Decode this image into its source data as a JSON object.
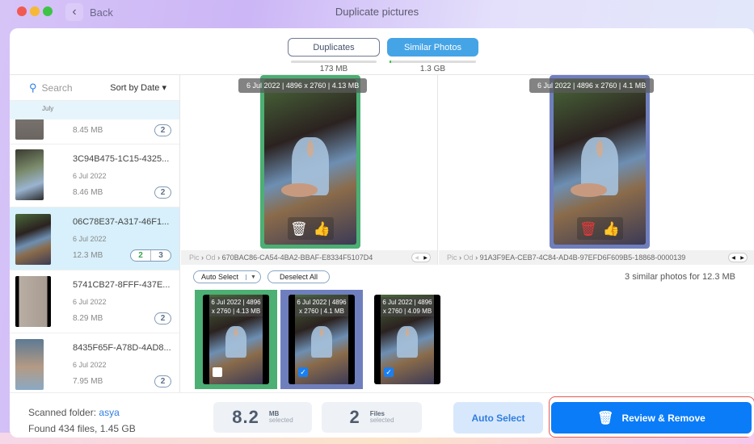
{
  "window": {
    "title": "Duplicate pictures",
    "back_label": "Back"
  },
  "tabs": [
    {
      "label": "Duplicates",
      "size": "173 MB",
      "active": false
    },
    {
      "label": "Similar Photos",
      "size": "1.3 GB",
      "active": true
    }
  ],
  "sidebar": {
    "search_placeholder": "Search",
    "sort_label": "Sort by Date",
    "section": "July",
    "items": [
      {
        "name": "",
        "date": "",
        "size": "8.45 MB",
        "badge": "2"
      },
      {
        "name": "3C94B475-1C15-4325...",
        "date": "6 Jul 2022",
        "size": "8.46 MB",
        "badge": "2"
      },
      {
        "name": "06C78E37-A317-46F1...",
        "date": "6 Jul 2022",
        "size": "12.3 MB",
        "badge_selected": "2",
        "badge_total": "3",
        "selected": true
      },
      {
        "name": "5741CB27-8FFF-437E...",
        "date": "6 Jul 2022",
        "size": "8.29 MB",
        "badge": "2"
      },
      {
        "name": "8435F65F-A78D-4AD8...",
        "date": "6 Jul 2022",
        "size": "7.95 MB",
        "badge": "2"
      }
    ]
  },
  "compare": {
    "left": {
      "meta": "6 Jul 2022 | 4896 x 2760 | 4.13 MB",
      "path_a": "Pic",
      "path_b": "Od",
      "path_file": "670BAC86-CA54-4BA2-BBAF-E8334F5107D4",
      "status": "keep"
    },
    "right": {
      "meta": "6 Jul 2022 | 4896 x 2760 | 4.1 MB",
      "path_a": "Pic",
      "path_b": "Od",
      "path_file": "91A3F9EA-CEB7-4C84-AD4B-97EFD6F609B5-18868-0000139",
      "status": "remove"
    },
    "separator": "›"
  },
  "group": {
    "auto_select_label": "Auto Select",
    "deselect_all_label": "Deselect All",
    "summary": "3 similar photos for 12.3 MB",
    "thumbs": [
      {
        "meta": "6 Jul 2022 | 4896 x 2760 | 4.13 MB",
        "checked": false
      },
      {
        "meta": "6 Jul 2022 | 4896 x 2760 | 4.1 MB",
        "checked": true
      },
      {
        "meta": "6 Jul 2022 | 4896 x 2760 | 4.09 MB",
        "checked": true
      }
    ]
  },
  "footer": {
    "scanned_label": "Scanned folder:",
    "scanned_folder": "asya",
    "found": "Found 434 files, 1.45 GB",
    "mb_value": "8.2",
    "mb_unit": "MB",
    "mb_sub": "selected",
    "files_value": "2",
    "files_unit": "Files",
    "files_sub": "selected",
    "auto_select_label": "Auto Select",
    "review_label": "Review & Remove"
  },
  "colors": {
    "keep": "#4caf73",
    "remove": "#6f7fbe",
    "accent": "#0a7cf8",
    "trash_red": "#e8393b"
  }
}
